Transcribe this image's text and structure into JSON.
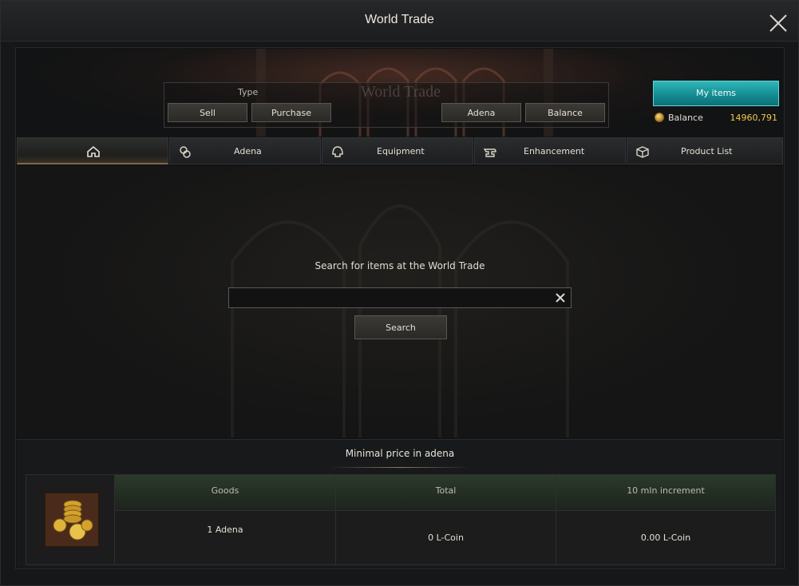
{
  "window": {
    "title": "World Trade"
  },
  "type_panel": {
    "label": "Type",
    "watermark": "World Trade",
    "buttons": {
      "sell": "Sell",
      "purchase": "Purchase",
      "adena": "Adena",
      "balance": "Balance"
    }
  },
  "account": {
    "my_items_label": "My items",
    "balance_label": "Balance",
    "balance_value": "14960,791"
  },
  "tabs": [
    {
      "label": "",
      "icon": "home-icon"
    },
    {
      "label": "Adena",
      "icon": "adena-icon"
    },
    {
      "label": "Equipment",
      "icon": "helmet-icon"
    },
    {
      "label": "Enhancement",
      "icon": "anvil-icon"
    },
    {
      "label": "Product List",
      "icon": "box-icon"
    }
  ],
  "search": {
    "heading": "Search for items at the World Trade",
    "value": "",
    "button_label": "Search"
  },
  "footer": {
    "title": "Minimal price in adena",
    "item_icon": "adena-coins-icon",
    "columns": [
      "Goods",
      "Total",
      "10 mln increment"
    ],
    "row": {
      "goods": "1 Adena",
      "total": "0 L-Coin",
      "increment": "0.00 L-Coin"
    }
  },
  "colors": {
    "accent_teal": "#138a90",
    "gold": "#f2c84a"
  }
}
